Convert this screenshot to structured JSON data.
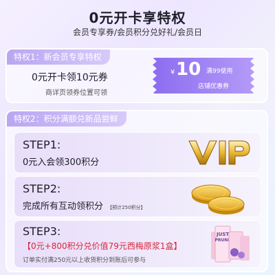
{
  "header": {
    "title": "0元开卡享特权",
    "subtitle": "会员专享券/会员积分兑好礼/会员日"
  },
  "privilege1": {
    "tag": "特权1：新会员专享特权",
    "main": "0元开卡领10元券",
    "note": "商详页领券位置可领",
    "coupon": {
      "currency": "¥",
      "amount": "10",
      "condition": "满99使用",
      "name": "店铺优惠券"
    }
  },
  "privilege2": {
    "tag": "特权2：积分满额兑新品尝鲜",
    "steps": [
      {
        "title": "STEP1:",
        "desc": "0元入会领300积分",
        "image_name": "vip"
      },
      {
        "title": "STEP2:",
        "desc": "完成所有互动领积分",
        "desc_note": "【预计250积分】",
        "image_name": "coins"
      },
      {
        "title": "STEP3:",
        "desc": "【0元+800积分兑价值79元西梅原浆1盒】",
        "note": "订单实付满250元以上收货积分到账后可参与",
        "image_name": "prune-juice-box"
      }
    ],
    "product_box_text": [
      "JUST",
      "PRUNE"
    ]
  },
  "colors": {
    "accent_purple": "#8c6cf0",
    "tag_purple": "#b9a6f2",
    "highlight_red": "#d7263d",
    "gold": "#e9b832"
  }
}
